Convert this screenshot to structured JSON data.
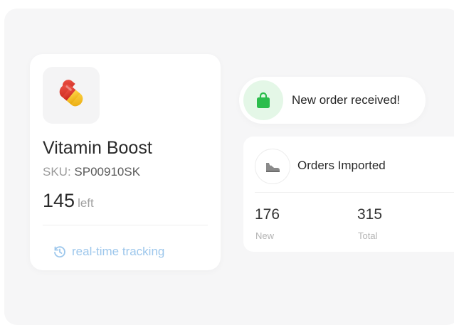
{
  "product": {
    "name": "Vitamin Boost",
    "sku_label": "SKU:",
    "sku_value": "SP00910SK",
    "stock_count": "145",
    "stock_unit": "left",
    "tracking_label": "real-time tracking",
    "icon": "pill-icon"
  },
  "notification": {
    "text": "New order received!",
    "icon": "shopping-bag-icon"
  },
  "orders": {
    "title": "Orders Imported",
    "icon": "shoe-icon",
    "stats": [
      {
        "value": "176",
        "label": "New"
      },
      {
        "value": "315",
        "label": "Total"
      }
    ]
  },
  "colors": {
    "accent_green": "#2bbd4c",
    "tracking_blue": "#9dc7ec",
    "pill_red": "#e13a2c",
    "pill_yellow": "#f5c21b"
  }
}
